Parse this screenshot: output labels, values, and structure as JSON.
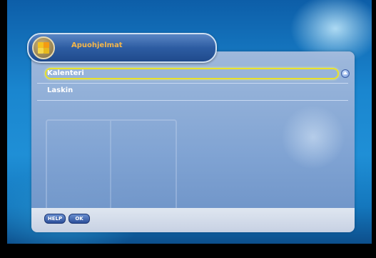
{
  "title": {
    "text": "Apuohjelmat",
    "icon": "tools-icon"
  },
  "menu": {
    "items": [
      {
        "label": "Kalenteri",
        "selected": true
      },
      {
        "label": "Laskin",
        "selected": false
      }
    ],
    "scroll_icon": "scroll-up-arrow-icon"
  },
  "footer": {
    "help_label": "HELP",
    "ok_label": "OK"
  },
  "colors": {
    "title_text": "#f4b64a",
    "highlight": "#e8e12c",
    "panel": "#9fb4d6",
    "footer": "#d3dbe9"
  }
}
